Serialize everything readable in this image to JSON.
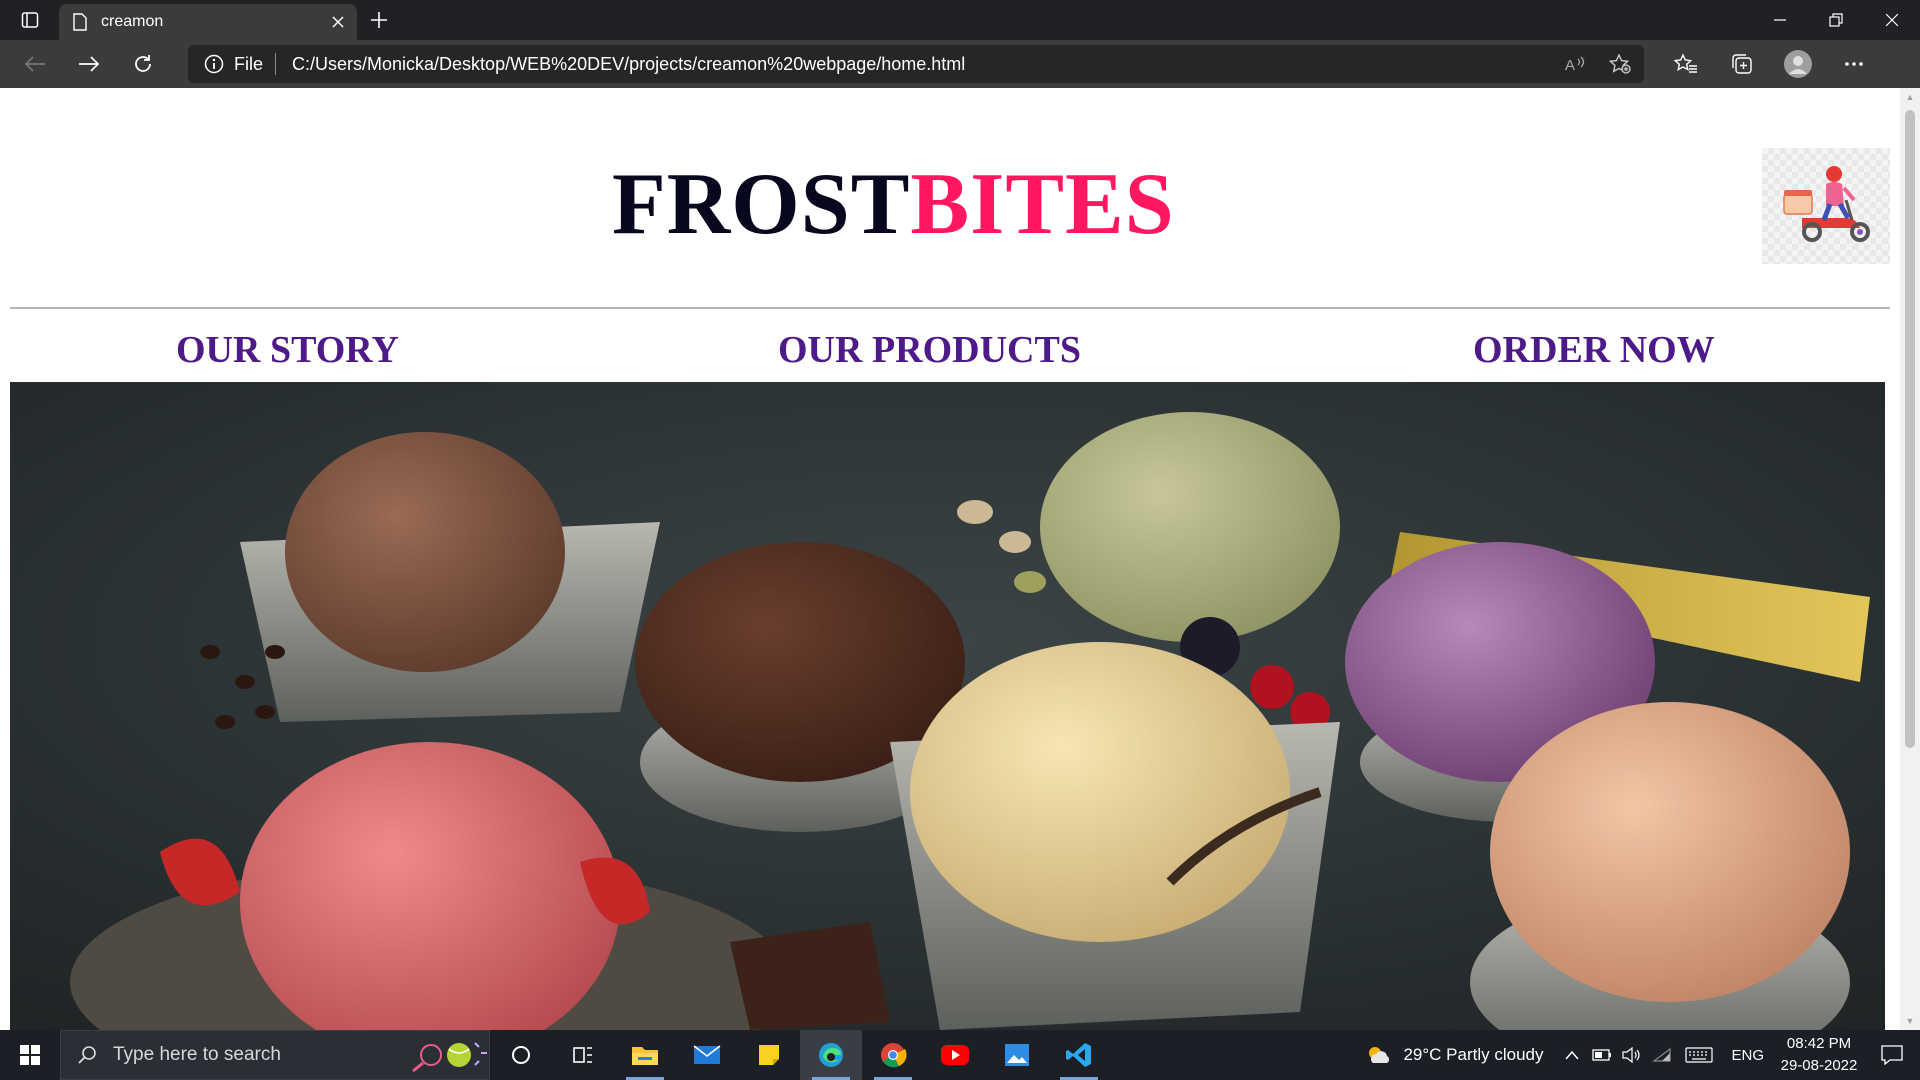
{
  "browser": {
    "tab_title": "creamon",
    "address": {
      "info_label": "File",
      "url": "C:/Users/Monicka/Desktop/WEB%20DEV/projects/creamon%20webpage/home.html"
    }
  },
  "page": {
    "brand_part1": "FROST",
    "brand_part2": "BITES",
    "nav": {
      "our_story": "OUR STORY",
      "our_products": "OUR PRODUCTS",
      "order_now": "ORDER NOW"
    },
    "colors": {
      "brand_dark": "#07081e",
      "brand_accent": "#ff1760",
      "nav_link": "#4d1a88"
    }
  },
  "taskbar": {
    "search_placeholder": "Type here to search",
    "weather": "29°C  Partly cloudy",
    "language": "ENG",
    "time": "08:42 PM",
    "date": "29-08-2022"
  }
}
